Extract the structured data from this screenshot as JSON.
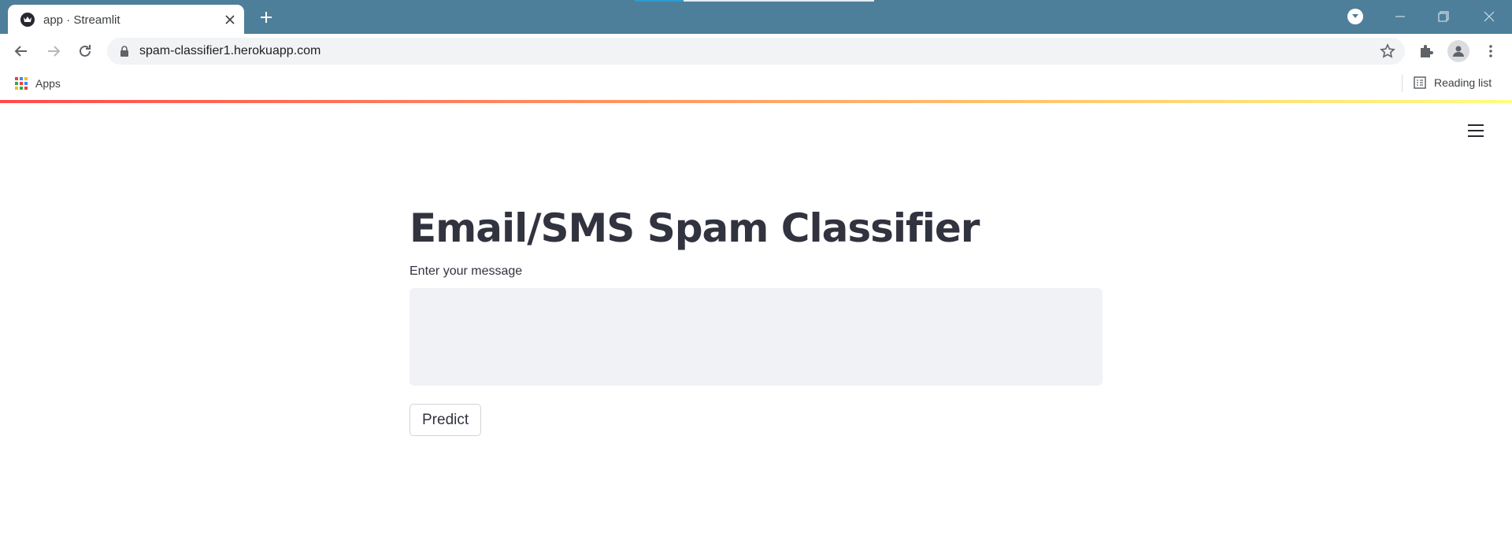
{
  "browser": {
    "tab": {
      "title": "app · Streamlit",
      "favicon": "streamlit-crown-icon"
    },
    "address_bar": {
      "url": "spam-classifier1.herokuapp.com"
    },
    "bookmarks": {
      "apps_label": "Apps",
      "reading_list_label": "Reading list"
    },
    "colors": {
      "titlebar": "#4e7f9a",
      "omnibox": "#f1f3f4"
    }
  },
  "app": {
    "title": "Email/SMS Spam Classifier",
    "input_label": "Enter your message",
    "input_value": "",
    "predict_label": "Predict",
    "colors": {
      "text": "#31333f",
      "input_background": "#f0f2f6",
      "decoration_start": "#ff4b4b",
      "decoration_end": "#fffd80"
    }
  }
}
